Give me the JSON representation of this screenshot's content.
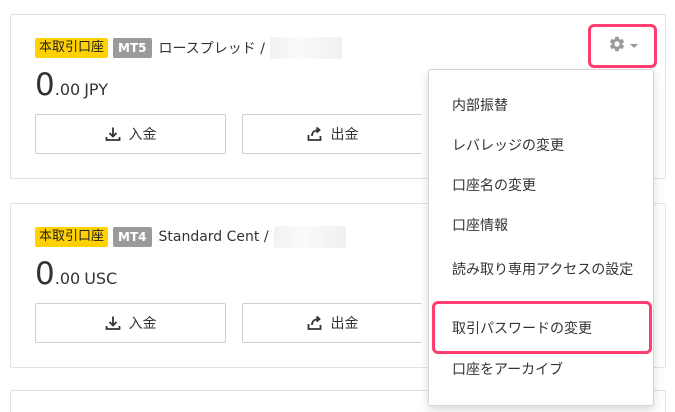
{
  "accounts": [
    {
      "type_badge": "本取引口座",
      "platform_badge": "MT5",
      "name": "ロースプレッド /",
      "balance_int": "0",
      "balance_dec": ".00",
      "currency": "JPY",
      "deposit_label": "入金",
      "withdraw_label": "出金"
    },
    {
      "type_badge": "本取引口座",
      "platform_badge": "MT4",
      "name": "Standard Cent /",
      "balance_int": "0",
      "balance_dec": ".00",
      "currency": "USC",
      "deposit_label": "入金",
      "withdraw_label": "出金"
    }
  ],
  "settings_menu": {
    "icon": "gear-icon",
    "items": [
      "内部振替",
      "レバレッジの変更",
      "口座名の変更",
      "口座情報",
      "読み取り専用アクセスの設定",
      "取引パスワードの変更",
      "口座をアーカイブ"
    ]
  },
  "colors": {
    "highlight": "#ff3d6e",
    "type_badge": "#ffd100",
    "platform_badge": "#9a9a9a"
  }
}
